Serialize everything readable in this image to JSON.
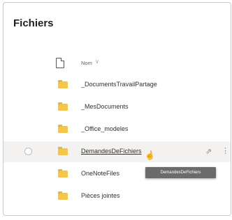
{
  "title": "Fichiers",
  "header": {
    "name_label": "Nom",
    "sort_chevron": "chevron-down-icon"
  },
  "rows": [
    {
      "name": "_DocumentsTravailPartage",
      "icon": "folder-icon"
    },
    {
      "name": "_MesDocuments",
      "icon": "folder-icon"
    },
    {
      "name": "_Office_modeles",
      "icon": "folder-icon"
    },
    {
      "name": "DemandesDeFichiers",
      "icon": "folder-icon",
      "hovered": true
    },
    {
      "name": "OneNoteFiles",
      "icon": "folder-icon"
    },
    {
      "name": "Pièces jointes",
      "icon": "folder-icon"
    }
  ],
  "tooltip": {
    "text": "DemandesDeFichiers"
  },
  "colors": {
    "folder": "#f3c64b",
    "hover_row": "#f3f2f1",
    "tooltip_bg": "#6b6b6b"
  }
}
